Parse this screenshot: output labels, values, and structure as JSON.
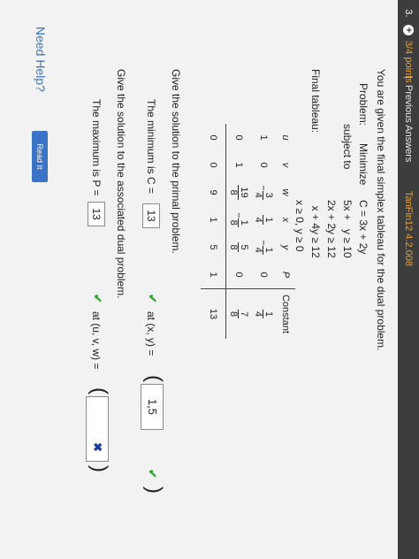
{
  "header": {
    "question_number": "3.",
    "points": "3/4 points",
    "separator": "|",
    "previous_answers": "Previous Answers",
    "problem_code": "TanFin12 4.2.008"
  },
  "problem": {
    "intro": "You are given the final simplex tableau for the dual problem.",
    "problem_label": "Problem:",
    "minimize_label": "Minimize",
    "objective": "C = 3x + 2y",
    "subject_label": "subject to",
    "constraints": [
      "5x +   y ≥ 10",
      "2x + 2y ≥ 12",
      "  x + 4y ≥ 12",
      "x ≥ 0, y ≥ 0"
    ]
  },
  "tableau": {
    "label": "Final tableau:",
    "headers": [
      "u",
      "v",
      "w",
      "x",
      "y",
      "P",
      "Constant"
    ],
    "row1": {
      "u": "1",
      "v": "0",
      "w_num": "3",
      "w_den": "4",
      "x_num": "1",
      "x_den": "4",
      "y_num": "1",
      "y_den": "4",
      "P": "0",
      "c_num": "1",
      "c_den": "4"
    },
    "row2": {
      "u": "0",
      "v": "1",
      "w_num": "19",
      "w_den": "8",
      "x_num": "1",
      "x_den": "8",
      "y_num": "5",
      "y_den": "8",
      "P": "0",
      "c_num": "7",
      "c_den": "8"
    },
    "row3": {
      "u": "0",
      "v": "0",
      "w": "9",
      "x": "1",
      "y": "5",
      "P": "1",
      "c": "13"
    }
  },
  "primal": {
    "prompt": "Give the solution to the primal problem.",
    "min_label": "The minimum is C =",
    "min_value": "13",
    "at_label": "at (x, y) =",
    "xy_value": "1,5"
  },
  "dual": {
    "prompt": "Give the solution to the associated dual problem.",
    "max_label": "The maximum is P =",
    "max_value": "13",
    "at_label": "at (u, v, w) =",
    "uvw_value": ""
  },
  "help": {
    "label": "Need Help?",
    "read_button": "Read It"
  },
  "colors": {
    "topbar": "#3d3d3d",
    "accent_orange": "#f0a020",
    "check_green": "#3aa33a",
    "cross_blue": "#1a3fa0",
    "link_blue": "#3b73c7"
  },
  "icons": {
    "correct": "check-icon",
    "incorrect": "cross-icon",
    "expand": "plus-circle-icon"
  }
}
